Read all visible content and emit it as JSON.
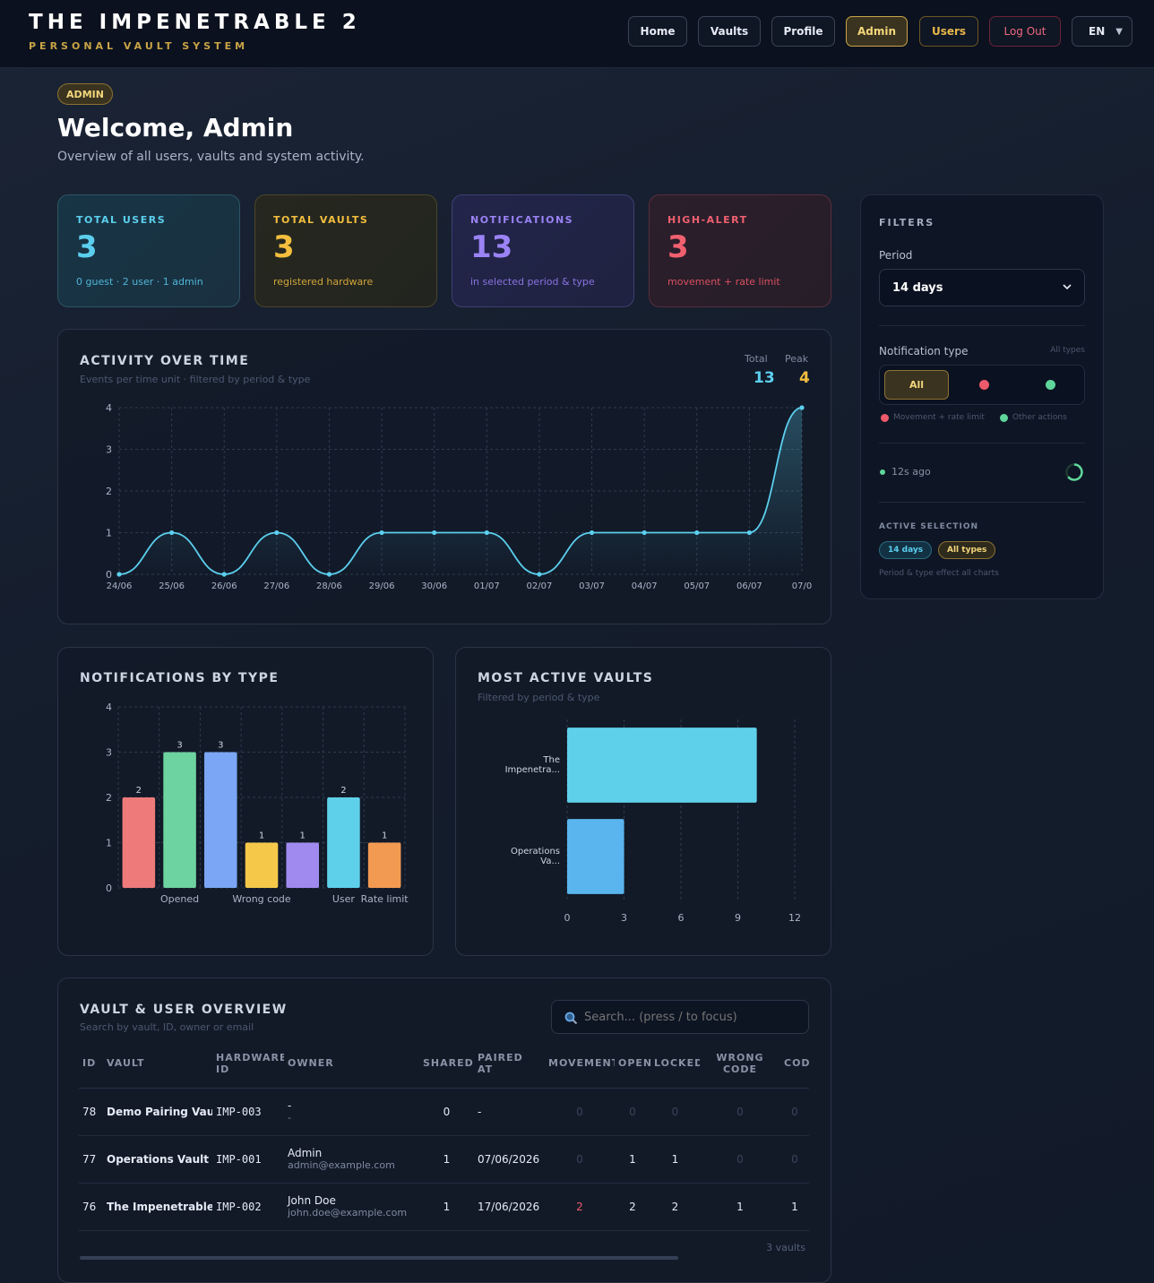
{
  "header": {
    "title": "THE IMPENETRABLE 2",
    "subtitle": "PERSONAL VAULT SYSTEM",
    "nav": {
      "home": "Home",
      "vaults": "Vaults",
      "profile": "Profile",
      "admin": "Admin",
      "users": "Users",
      "logout": "Log Out",
      "language": "EN",
      "language_caret": "▼"
    }
  },
  "page": {
    "badge": "ADMIN",
    "title": "Welcome, Admin",
    "subtitle": "Overview of all users, vaults and system activity."
  },
  "stats": {
    "users": {
      "label": "TOTAL USERS",
      "value": "3",
      "sub": "0 guest · 2 user · 1 admin"
    },
    "vaults": {
      "label": "TOTAL VAULTS",
      "value": "3",
      "sub": "registered hardware"
    },
    "notifications": {
      "label": "NOTIFICATIONS",
      "value": "13",
      "sub": "in selected period & type"
    },
    "alerts": {
      "label": "HIGH-ALERT",
      "value": "3",
      "sub": "movement + rate limit"
    }
  },
  "activity": {
    "title": "ACTIVITY OVER TIME",
    "subtitle": "Events per time unit · filtered by period & type",
    "total_label": "Total",
    "total_value": "13",
    "peak_label": "Peak",
    "peak_value": "4"
  },
  "notif_by_type": {
    "title": "NOTIFICATIONS BY TYPE"
  },
  "most_active": {
    "title": "MOST ACTIVE VAULTS",
    "subtitle": "Filtered by period & type"
  },
  "chart_data": [
    {
      "type": "line",
      "x": [
        "24/06",
        "25/06",
        "26/06",
        "27/06",
        "28/06",
        "29/06",
        "30/06",
        "01/07",
        "02/07",
        "03/07",
        "04/07",
        "05/07",
        "06/07",
        "07/0"
      ],
      "series": [
        {
          "values": [
            0,
            1,
            0,
            1,
            0,
            1,
            1,
            1,
            0,
            1,
            1,
            1,
            1,
            4
          ]
        }
      ],
      "yticks": [
        0,
        1,
        2,
        3,
        4
      ],
      "ylim": [
        0,
        4
      ],
      "grid": true,
      "color": "#5ccfee"
    },
    {
      "type": "bar",
      "categories": [
        "",
        "Opened",
        "",
        "Wrong code",
        "",
        "User",
        "Rate limit"
      ],
      "values": [
        2,
        3,
        3,
        1,
        1,
        2,
        1
      ],
      "colors": [
        "#ee7a7a",
        "#6dd3a0",
        "#7aa6f5",
        "#f5c84a",
        "#a08af0",
        "#5fd0ea",
        "#f39a52"
      ],
      "yticks": [
        0,
        1,
        2,
        3,
        4
      ],
      "ylim": [
        0,
        4
      ],
      "grid": true
    },
    {
      "type": "bar",
      "orientation": "horizontal",
      "categories": [
        [
          "The",
          "Impenetra..."
        ],
        [
          "Operations",
          "Va..."
        ]
      ],
      "values": [
        10,
        3
      ],
      "colors": [
        "#5fd0ea",
        "#5ab5ee"
      ],
      "xticks": [
        0,
        3,
        6,
        9,
        12
      ],
      "xlim": [
        0,
        12
      ],
      "grid": true
    }
  ],
  "filters": {
    "title": "FILTERS",
    "period_label": "Period",
    "period_value": "14 days",
    "type_label": "Notification type",
    "type_hint": "All types",
    "type_all": "All",
    "legend_movement": "Movement + rate limit",
    "legend_other": "Other actions",
    "color_movement": "#ee5a6a",
    "color_other": "#5fd69a",
    "refresh_text": "12s ago",
    "selection_title": "ACTIVE SELECTION",
    "chip_period": "14 days",
    "chip_type": "All types",
    "note": "Period & type effect all charts"
  },
  "overview": {
    "title": "VAULT & USER OVERVIEW",
    "subtitle": "Search by vault, ID, owner or email",
    "search_placeholder": "Search... (press / to focus)",
    "columns": [
      "ID",
      "VAULT",
      "HARDWARE ID",
      "OWNER",
      "SHARED",
      "PAIRED AT",
      "MOVEMENT",
      "OPEN",
      "LOCKED",
      "WRONG CODE",
      "CODI"
    ],
    "rows": [
      {
        "id": "78",
        "vault": "Demo Pairing Vault",
        "hw": "IMP-003",
        "owner": "-",
        "email": "-",
        "shared": "0",
        "paired": "-",
        "movement": "0",
        "open": "0",
        "locked": "0",
        "wrong": "0",
        "code": "0"
      },
      {
        "id": "77",
        "vault": "Operations Vault",
        "hw": "IMP-001",
        "owner": "Admin",
        "email": "admin@example.com",
        "shared": "1",
        "paired": "07/06/2026",
        "movement": "0",
        "open": "1",
        "locked": "1",
        "wrong": "0",
        "code": "0"
      },
      {
        "id": "76",
        "vault": "The Impenetrable II",
        "hw": "IMP-002",
        "owner": "John Doe",
        "email": "john.doe@example.com",
        "shared": "1",
        "paired": "17/06/2026",
        "movement": "2",
        "open": "2",
        "locked": "2",
        "wrong": "1",
        "code": "1"
      }
    ],
    "footer": "3 vaults"
  }
}
